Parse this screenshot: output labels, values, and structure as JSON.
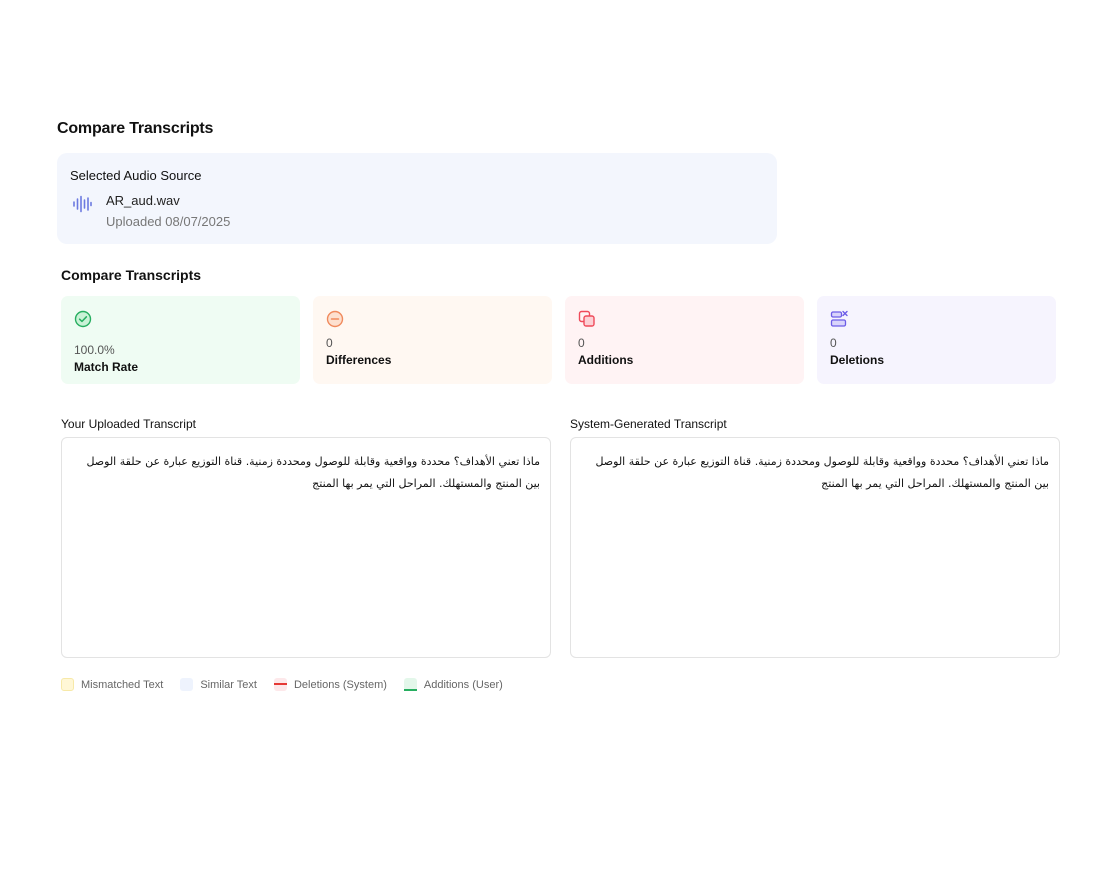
{
  "page": {
    "title": "Compare Transcripts"
  },
  "source": {
    "heading": "Selected Audio Source",
    "icon": "audio-wave-icon",
    "filename": "AR_aud.wav",
    "uploaded": "Uploaded 08/07/2025"
  },
  "compare": {
    "title": "Compare Transcripts",
    "stats": [
      {
        "value": "100.0%",
        "label": "Match Rate",
        "icon": "check-circle-icon",
        "bg": "#effcf3",
        "accent": "#27ae60"
      },
      {
        "value": "0",
        "label": "Differences",
        "icon": "minus-circle-icon",
        "bg": "#fff8f2",
        "accent": "#f08a5d"
      },
      {
        "value": "0",
        "label": "Additions",
        "icon": "copy-squares-icon",
        "bg": "#fff3f4",
        "accent": "#ef4a5a"
      },
      {
        "value": "0",
        "label": "Deletions",
        "icon": "list-remove-icon",
        "bg": "#f6f4fe",
        "accent": "#6c5ce7"
      }
    ]
  },
  "transcripts": {
    "uploaded": {
      "label": "Your Uploaded Transcript",
      "text": "ماذا تعني الأهداف؟ محددة وواقعية وقابلة للوصول ومحددة زمنية. قناة التوزيع عبارة عن حلقة الوصل بين المنتج والمستهلك. المراحل التي يمر بها المنتج"
    },
    "system": {
      "label": "System-Generated Transcript",
      "text": "ماذا تعني الأهداف؟ محددة وواقعية وقابلة للوصول ومحددة زمنية. قناة التوزيع عبارة عن حلقة الوصل بين المنتج والمستهلك. المراحل التي يمر بها المنتج"
    }
  },
  "legend": {
    "mismatched": "Mismatched Text",
    "similar": "Similar Text",
    "deletions": "Deletions (System)",
    "additions": "Additions (User)"
  }
}
